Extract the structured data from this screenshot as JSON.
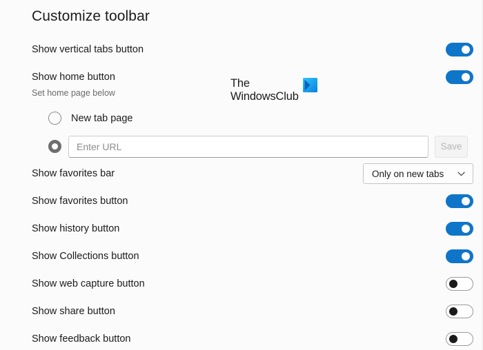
{
  "page": {
    "title": "Customize toolbar"
  },
  "home_page": {
    "sub_label": "Set home page below",
    "options": [
      {
        "label": "New tab page",
        "selected": false
      },
      {
        "label": "",
        "selected": true
      }
    ],
    "url_input": {
      "value": "",
      "placeholder": "Enter URL"
    },
    "save_label": "Save"
  },
  "favorites_bar": {
    "label": "Show favorites bar",
    "dropdown_value": "Only on new tabs",
    "dropdown_icon": "chevron-down-icon",
    "options": [
      "Only on new tabs"
    ]
  },
  "settings": [
    {
      "label": "Show vertical tabs button",
      "state": "on",
      "control": "toggle"
    },
    {
      "label": "Show home button",
      "state": "on",
      "control": "toggle"
    },
    {
      "label": "Show favorites button",
      "state": "on",
      "control": "toggle"
    },
    {
      "label": "Show history button",
      "state": "on",
      "control": "toggle"
    },
    {
      "label": "Show Collections button",
      "state": "on",
      "control": "toggle"
    },
    {
      "label": "Show web capture button",
      "state": "off",
      "control": "toggle"
    },
    {
      "label": "Show share button",
      "state": "off",
      "control": "toggle"
    },
    {
      "label": "Show feedback button",
      "state": "off",
      "control": "toggle"
    }
  ],
  "watermark": {
    "line1": "The",
    "line2": "WindowsClub",
    "logo_icon": "windowsclub-logo-icon"
  },
  "colors": {
    "toggle_on": "#0f75c9",
    "background": "#fbfbfb",
    "text": "#1b1b1b",
    "muted_text": "#6b6b6b"
  }
}
